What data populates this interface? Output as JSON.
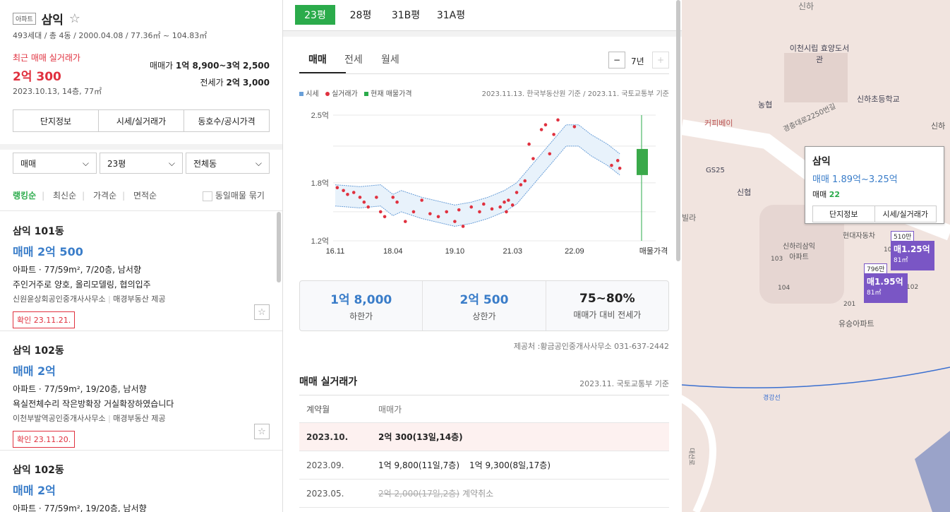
{
  "complex": {
    "type_badge": "아파트",
    "name": "삼익",
    "star": "☆",
    "summary": "493세대 / 총 4동 / 2000.04.08 / 77.36㎡ ~ 104.83㎡",
    "recent_label": "최근 매매 실거래가",
    "recent_price": "2억 300",
    "recent_detail": "2023.10.13, 14층, 77㎡",
    "sale_label": "매매가",
    "sale_range": "1억 8,900~3억 2,500",
    "jeonse_label": "전세가",
    "jeonse_value": "2억 3,000"
  },
  "buttons": {
    "info": "단지정보",
    "price": "시세/실거래가",
    "unit": "동호수/공시가격"
  },
  "filters": {
    "deal": "매매",
    "size": "23평",
    "dong": "전체동"
  },
  "sort": {
    "ranking": "랭킹순",
    "latest": "최신순",
    "price": "가격순",
    "area": "면적순",
    "group": "동일매물 묶기"
  },
  "listings": [
    {
      "title": "삼익 101동",
      "price": "매매 2억 500",
      "detail": "아파트 · 77/59m², 7/20층, 남서향",
      "desc": "주인거주로 양호, 올리모델링, 협의입주",
      "broker": "신원윤상회공인중개사사무소",
      "provider": "매경부동산 제공",
      "confirm": "확인 23.11.21."
    },
    {
      "title": "삼익 102동",
      "price": "매매 2억",
      "detail": "아파트 · 77/59m², 19/20층, 남서향",
      "desc": "욕실전체수리 작은방확장 거실확장하였습니다",
      "broker": "이천부발역공인중개사사무소",
      "provider": "매경부동산 제공",
      "confirm": "확인 23.11.20."
    },
    {
      "title": "삼익 102동",
      "price": "매매 2억",
      "detail": "아파트 · 77/59m², 19/20층, 남서향",
      "desc": "",
      "broker": "",
      "provider": "",
      "confirm": ""
    }
  ],
  "size_tabs": [
    "23평",
    "28평",
    "31B평",
    "31A평"
  ],
  "deal_tabs": [
    "매매",
    "전세",
    "월세"
  ],
  "period": {
    "minus": "−",
    "value": "7년",
    "plus": "+"
  },
  "legend": {
    "market": "시세",
    "actual": "실거래가",
    "current": "현재 매물가격",
    "source": "2023.11.13. 한국부동산원 기준 / 2023.11. 국토교통부 기준"
  },
  "chart_data": {
    "type": "scatter",
    "ylim": [
      1.2,
      2.5
    ],
    "yticks": [
      "2.5억",
      "1.8억",
      "1.2억"
    ],
    "xticks": [
      "16.11",
      "18.04",
      "19.10",
      "21.03",
      "22.09",
      "매물가격"
    ],
    "series": [
      {
        "name": "시세",
        "values": [
          [
            2016.9,
            1.68
          ],
          [
            2017.5,
            1.66
          ],
          [
            2018.0,
            1.68
          ],
          [
            2018.3,
            1.58
          ],
          [
            2018.5,
            1.62
          ],
          [
            2019.0,
            1.55
          ],
          [
            2019.5,
            1.5
          ],
          [
            2019.8,
            1.47
          ],
          [
            2020.2,
            1.5
          ],
          [
            2020.6,
            1.55
          ],
          [
            2021.0,
            1.62
          ],
          [
            2021.3,
            1.7
          ],
          [
            2021.6,
            1.85
          ],
          [
            2021.9,
            2.0
          ],
          [
            2022.2,
            2.15
          ],
          [
            2022.5,
            2.3
          ],
          [
            2022.8,
            2.3
          ],
          [
            2023.1,
            2.2
          ],
          [
            2023.5,
            2.1
          ],
          [
            2023.8,
            2.0
          ]
        ]
      },
      {
        "name": "실거래가",
        "values": [
          [
            2016.95,
            1.75
          ],
          [
            2017.1,
            1.72
          ],
          [
            2017.2,
            1.68
          ],
          [
            2017.35,
            1.7
          ],
          [
            2017.5,
            1.65
          ],
          [
            2017.6,
            1.6
          ],
          [
            2017.7,
            1.55
          ],
          [
            2017.9,
            1.65
          ],
          [
            2018.0,
            1.5
          ],
          [
            2018.1,
            1.45
          ],
          [
            2018.3,
            1.65
          ],
          [
            2018.4,
            1.6
          ],
          [
            2018.6,
            1.4
          ],
          [
            2018.8,
            1.5
          ],
          [
            2019.0,
            1.62
          ],
          [
            2019.2,
            1.48
          ],
          [
            2019.4,
            1.45
          ],
          [
            2019.6,
            1.5
          ],
          [
            2019.8,
            1.4
          ],
          [
            2019.9,
            1.52
          ],
          [
            2020.0,
            1.35
          ],
          [
            2020.2,
            1.55
          ],
          [
            2020.4,
            1.5
          ],
          [
            2020.5,
            1.58
          ],
          [
            2020.7,
            1.53
          ],
          [
            2020.9,
            1.55
          ],
          [
            2021.0,
            1.6
          ],
          [
            2021.05,
            1.5
          ],
          [
            2021.1,
            1.62
          ],
          [
            2021.2,
            1.57
          ],
          [
            2021.3,
            1.7
          ],
          [
            2021.4,
            1.78
          ],
          [
            2021.5,
            1.82
          ],
          [
            2021.6,
            2.2
          ],
          [
            2021.7,
            2.05
          ],
          [
            2021.9,
            2.35
          ],
          [
            2022.0,
            2.4
          ],
          [
            2022.1,
            2.1
          ],
          [
            2022.2,
            2.3
          ],
          [
            2022.3,
            2.45
          ],
          [
            2022.7,
            2.38
          ],
          [
            2023.6,
            1.98
          ],
          [
            2023.75,
            2.03
          ],
          [
            2023.8,
            1.95
          ]
        ]
      }
    ],
    "current_range": [
      1.89,
      3.25
    ],
    "note": ""
  },
  "stats": {
    "low_val": "1억 8,000",
    "low_label": "하한가",
    "high_val": "2억 500",
    "high_label": "상한가",
    "ratio_val": "75~80%",
    "ratio_label": "매매가 대비 전세가"
  },
  "provider_note": "제공처 :황금공인중개사사무소 031-637-2442",
  "actual": {
    "title": "매매 실거래가",
    "basis": "2023.11. 국토교통부 기준",
    "h_date": "계약월",
    "h_price": "매매가",
    "rows": [
      {
        "date": "2023.10.",
        "p1": "2억 300(13일,14층)",
        "p2": ""
      },
      {
        "date": "2023.09.",
        "p1": "1억 9,800(11일,7층)",
        "p2": "1억 9,300(8일,17층)"
      },
      {
        "date": "2023.05.",
        "p1": "2억 2,000(17일,2층)",
        "p2": "계약취소"
      }
    ]
  },
  "map": {
    "lib": "이천시립 효양도서관",
    "school": "신하초등학교",
    "cafe": "커피베이",
    "bank": "농협",
    "gs": "GS25",
    "bank2": "신협",
    "road": "경충대로2250번길",
    "apt": "신하리삼익 아파트",
    "apt2": "유승아파트",
    "villa": "빌라",
    "car": "현대자동차",
    "rail": "경강선",
    "road2": "대산로",
    "shinha": "신하",
    "n103": "103",
    "n104": "104",
    "n101": "101",
    "n201": "201",
    "n102": "102",
    "n2": "2",
    "popup": {
      "name": "삼익",
      "range": "매매 1.89억~3.25억",
      "count_label": "매매",
      "count": "22",
      "btn1": "단지정보",
      "btn2": "시세/실거래가"
    },
    "tag1": {
      "top": "510만",
      "price": "매1.25억",
      "area": "81㎡"
    },
    "tag2": {
      "top": "796만",
      "price": "매1.95억",
      "area": "81㎡"
    }
  }
}
